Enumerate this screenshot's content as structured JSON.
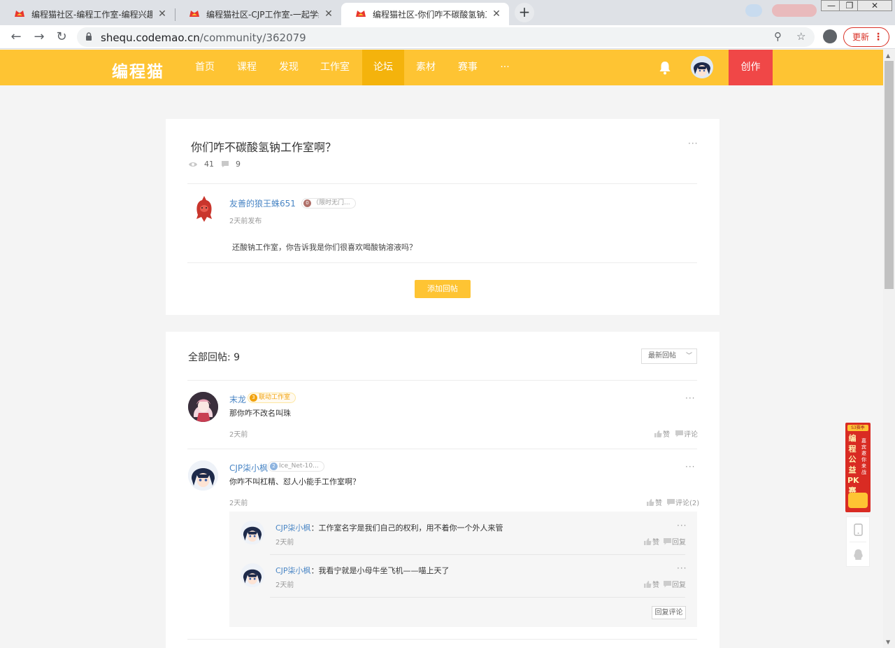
{
  "browser": {
    "tabs": [
      {
        "title": "编程猫社区-编程工作室-编程兴趣",
        "active": false
      },
      {
        "title": "编程猫社区-CJP工作室-一起学编程",
        "active": false
      },
      {
        "title": "编程猫社区-你们咋不碳酸氢钠工",
        "active": true
      }
    ],
    "new_tab_label": "+",
    "url_domain": "shequ.codemao.cn",
    "url_path": "/community/362079",
    "update_label": "更新",
    "close_glyph": "✕"
  },
  "site": {
    "logo": "编程猫",
    "nav": [
      "首页",
      "课程",
      "发现",
      "工作室",
      "论坛",
      "素材",
      "赛事",
      "···"
    ],
    "active_nav": "论坛",
    "create_label": "创作",
    "brand_color": "#fec433",
    "create_color": "#f04747"
  },
  "post": {
    "title": "你们咋不碳酸氢钠工作室啊？",
    "views": "41",
    "comments": "9",
    "author": "友善的狼王蛛651",
    "author_badge_level": "0",
    "author_badge": "（限时无门...",
    "time": "2天前发布",
    "body": "还酸钠工作室，你告诉我是你们很喜欢喝酸钠溶液吗？",
    "add_reply_label": "添加回帖"
  },
  "replies": {
    "header": "全部回帖: 9",
    "sort_label": "最新回帖",
    "items": [
      {
        "user": "末龙",
        "badge_level": "3",
        "badge": "联动工作室",
        "text": "那你咋不改名叫珠",
        "time": "2天前",
        "like": "赞",
        "comment": "评论"
      },
      {
        "user": "CJP柒小枫",
        "badge_level": "2",
        "badge": "Ice_Net-10...",
        "text": "你咋不叫杠精、怼人小能手工作室啊？",
        "time": "2天前",
        "like": "赞",
        "comment": "评论(2)",
        "sub": [
          {
            "user": "CJP柒小枫",
            "text": "：工作室名字是我们自己的权利，用不着你一个外人来管",
            "time": "2天前",
            "like": "赞",
            "reply": "回复"
          },
          {
            "user": "CJP柒小枫",
            "text": "：我看宁就是小母牛坐飞机——喵上天了",
            "time": "2天前",
            "like": "赞",
            "reply": "回复"
          }
        ],
        "reply_comment_label": "回复评论"
      }
    ]
  },
  "side_banner": {
    "top": "S3赛季",
    "main": "编程公益PK赛",
    "sub": "嘉宾邀你来战"
  }
}
